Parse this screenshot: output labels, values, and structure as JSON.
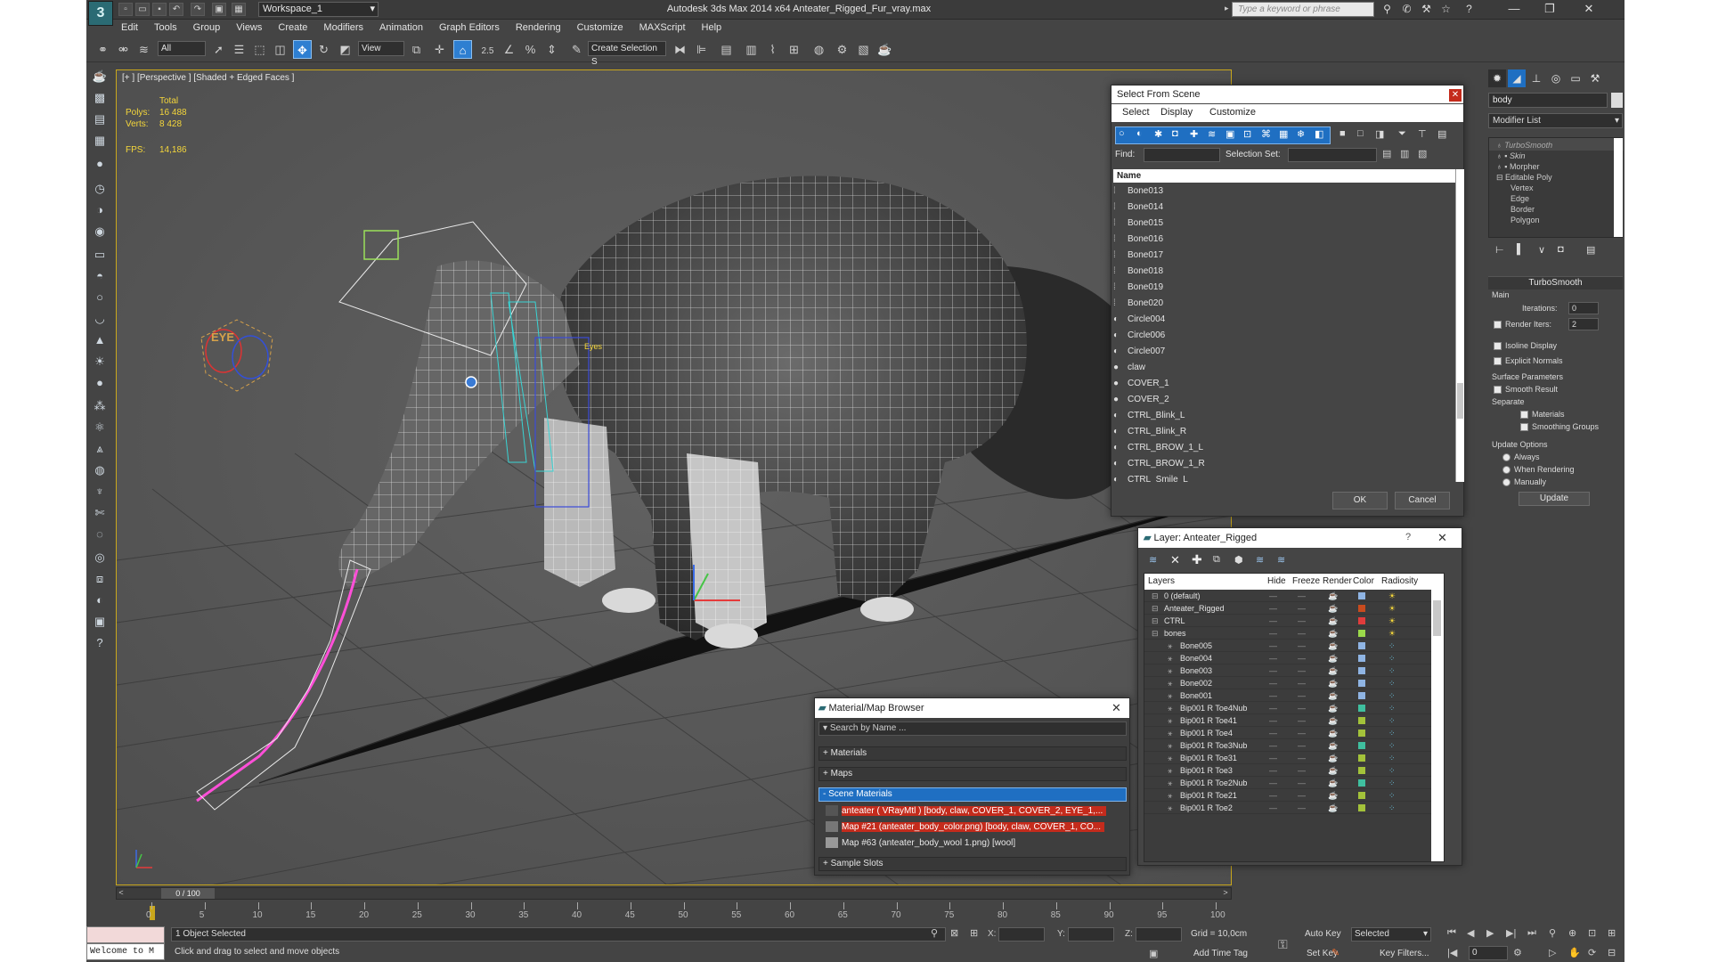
{
  "titlebar": {
    "workspace": "Workspace_1",
    "app_title": "Autodesk 3ds Max  2014 x64      Anteater_Rigged_Fur_vray.max",
    "search_placeholder": "Type a keyword or phrase"
  },
  "menu": [
    "Edit",
    "Tools",
    "Group",
    "Views",
    "Create",
    "Modifiers",
    "Animation",
    "Graph Editors",
    "Rendering",
    "Customize",
    "MAXScript",
    "Help"
  ],
  "toolbar": {
    "filter": "All",
    "ref_coord": "View",
    "selection_set": "Create Selection S",
    "snap_label": "2.5",
    "percent_label": "%"
  },
  "viewport": {
    "label": "[+ ] [Perspective ] [Shaded + Edged Faces ]",
    "stats_header": "Total",
    "polys_label": "Polys:",
    "polys_value": "16 488",
    "verts_label": "Verts:",
    "verts_value": "8 428",
    "fps_label": "FPS:",
    "fps_value": "14,186",
    "eye_label": "EYE",
    "eye_small": "Eyes"
  },
  "select_from_scene": {
    "title": "Select From Scene",
    "menu": [
      "Select",
      "Display",
      "Customize"
    ],
    "find_label": "Find:",
    "selection_set_label": "Selection Set:",
    "column_name": "Name",
    "rows": [
      "Bone013",
      "Bone014",
      "Bone015",
      "Bone016",
      "Bone017",
      "Bone018",
      "Bone019",
      "Bone020",
      "Circle004",
      "Circle006",
      "Circle007",
      "claw",
      "COVER_1",
      "COVER_2",
      "CTRL_Blink_L",
      "CTRL_Blink_R",
      "CTRL_BROW_1_L",
      "CTRL_BROW_1_R",
      "CTRL_Smile_L"
    ],
    "ok": "OK",
    "cancel": "Cancel"
  },
  "layer_dialog": {
    "title": "Layer: Anteater_Rigged",
    "help": "?",
    "columns": [
      "Layers",
      "Hide",
      "Freeze",
      "Render",
      "Color",
      "Radiosity"
    ],
    "rows": [
      {
        "name": "0 (default)",
        "color": "#8fb4e3"
      },
      {
        "name": "Anteater_Rigged",
        "color": "#c84b1e"
      },
      {
        "name": "CTRL",
        "color": "#e03c3c"
      },
      {
        "name": "bones",
        "color": "#9bd94a"
      },
      {
        "name": "Bone005",
        "color": "#8fb4e3"
      },
      {
        "name": "Bone004",
        "color": "#8fb4e3"
      },
      {
        "name": "Bone003",
        "color": "#8fb4e3"
      },
      {
        "name": "Bone002",
        "color": "#8fb4e3"
      },
      {
        "name": "Bone001",
        "color": "#8fb4e3"
      },
      {
        "name": "Bip001 R Toe4Nub",
        "color": "#3fbf9f"
      },
      {
        "name": "Bip001 R Toe41",
        "color": "#a3c23a"
      },
      {
        "name": "Bip001 R Toe4",
        "color": "#a3c23a"
      },
      {
        "name": "Bip001 R Toe3Nub",
        "color": "#3fbf9f"
      },
      {
        "name": "Bip001 R Toe31",
        "color": "#a3c23a"
      },
      {
        "name": "Bip001 R Toe3",
        "color": "#a3c23a"
      },
      {
        "name": "Bip001 R Toe2Nub",
        "color": "#3fbf9f"
      },
      {
        "name": "Bip001 R Toe21",
        "color": "#a3c23a"
      },
      {
        "name": "Bip001 R Toe2",
        "color": "#a3c23a"
      }
    ]
  },
  "material_browser": {
    "title": "Material/Map Browser",
    "search_placeholder": "Search by Name ...",
    "groups": [
      "+ Materials",
      "+ Maps",
      "- Scene Materials"
    ],
    "items": [
      "anteater  ( VRayMtl )  [body, claw, COVER_1, COVER_2, EYE_1,...",
      "Map #21 (anteater_body_color.png)  [body, claw, COVER_1, CO...",
      "Map #63 (anteater_body_wool 1.png)  [wool]"
    ],
    "sample_slots": "+ Sample Slots"
  },
  "command_panel": {
    "object_name": "body",
    "modifier_list": "Modifier List",
    "stack": [
      "TurboSmooth",
      "Skin",
      "Morpher",
      "Editable Poly",
      "Vertex",
      "Edge",
      "Border",
      "Polygon"
    ],
    "rollout": "TurboSmooth",
    "main": "Main",
    "iterations_label": "Iterations:",
    "iterations_value": "0",
    "render_iters_label": "Render Iters:",
    "render_iters_value": "2",
    "isoline": "Isoline Display",
    "explicit": "Explicit Normals",
    "surface_params": "Surface Parameters",
    "smooth_result": "Smooth Result",
    "separate": "Separate",
    "materials": "Materials",
    "smoothing_groups": "Smoothing Groups",
    "update_options": "Update Options",
    "always": "Always",
    "when_rendering": "When Rendering",
    "manually": "Manually",
    "update": "Update"
  },
  "timeline": {
    "frame": "0 / 100",
    "ticks": [
      "0",
      "5",
      "10",
      "15",
      "20",
      "25",
      "30",
      "35",
      "40",
      "45",
      "50",
      "55",
      "60",
      "65",
      "70",
      "75",
      "80",
      "85",
      "90",
      "95",
      "100"
    ]
  },
  "statusbar": {
    "maxscript": "Welcome to M",
    "selected": "1 Object Selected",
    "prompt": "Click and drag to select and move objects",
    "x_label": "X:",
    "y_label": "Y:",
    "z_label": "Z:",
    "grid": "Grid = 10,0cm",
    "add_time_tag": "Add Time Tag",
    "auto_key": "Auto Key",
    "set_key": "Set Key",
    "selected_dropdown": "Selected",
    "key_filters": "Key Filters...",
    "frame_field": "0"
  }
}
